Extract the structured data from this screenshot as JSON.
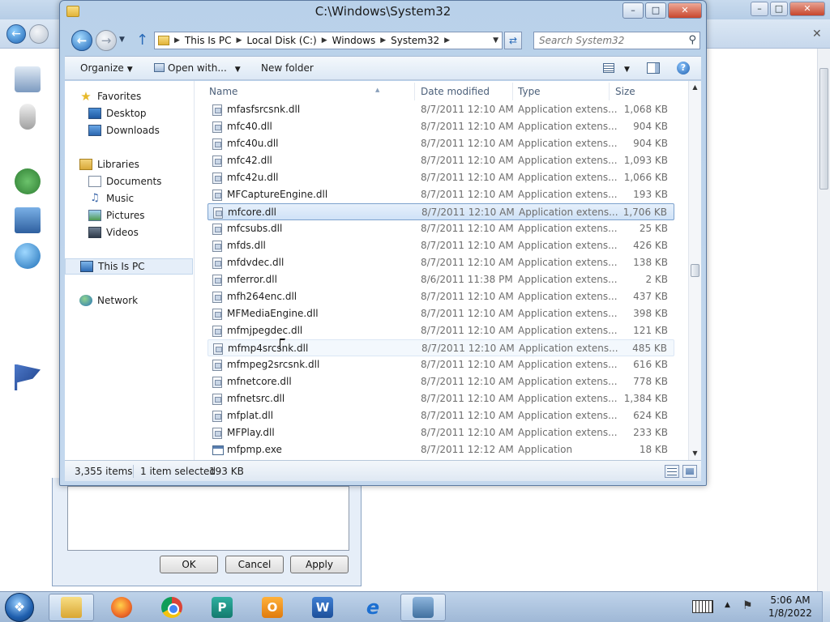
{
  "explorer": {
    "title": "C:\\Windows\\System32",
    "breadcrumb": [
      "This Is PC",
      "Local Disk (C:)",
      "Windows",
      "System32"
    ],
    "search_placeholder": "Search System32",
    "toolbar": {
      "organize": "Organize",
      "open_with": "Open with...",
      "new_folder": "New folder"
    },
    "nav": {
      "favorites": "Favorites",
      "desktop": "Desktop",
      "downloads": "Downloads",
      "libraries": "Libraries",
      "documents": "Documents",
      "music": "Music",
      "pictures": "Pictures",
      "videos": "Videos",
      "this_pc": "This Is PC",
      "network": "Network"
    },
    "columns": {
      "name": "Name",
      "date": "Date modified",
      "type": "Type",
      "size": "Size"
    },
    "files": [
      {
        "name": "mfasfsrcsnk.dll",
        "date": "8/7/2011 12:10 AM",
        "type": "Application extens...",
        "size": "1,068 KB"
      },
      {
        "name": "mfc40.dll",
        "date": "8/7/2011 12:10 AM",
        "type": "Application extens...",
        "size": "904 KB"
      },
      {
        "name": "mfc40u.dll",
        "date": "8/7/2011 12:10 AM",
        "type": "Application extens...",
        "size": "904 KB"
      },
      {
        "name": "mfc42.dll",
        "date": "8/7/2011 12:10 AM",
        "type": "Application extens...",
        "size": "1,093 KB"
      },
      {
        "name": "mfc42u.dll",
        "date": "8/7/2011 12:10 AM",
        "type": "Application extens...",
        "size": "1,066 KB"
      },
      {
        "name": "MFCaptureEngine.dll",
        "date": "8/7/2011 12:10 AM",
        "type": "Application extens...",
        "size": "193 KB"
      },
      {
        "name": "mfcore.dll",
        "date": "8/7/2011 12:10 AM",
        "type": "Application extens...",
        "size": "1,706 KB"
      },
      {
        "name": "mfcsubs.dll",
        "date": "8/7/2011 12:10 AM",
        "type": "Application extens...",
        "size": "25 KB"
      },
      {
        "name": "mfds.dll",
        "date": "8/7/2011 12:10 AM",
        "type": "Application extens...",
        "size": "426 KB"
      },
      {
        "name": "mfdvdec.dll",
        "date": "8/7/2011 12:10 AM",
        "type": "Application extens...",
        "size": "138 KB"
      },
      {
        "name": "mferror.dll",
        "date": "8/6/2011 11:38 PM",
        "type": "Application extens...",
        "size": "2 KB"
      },
      {
        "name": "mfh264enc.dll",
        "date": "8/7/2011 12:10 AM",
        "type": "Application extens...",
        "size": "437 KB"
      },
      {
        "name": "MFMediaEngine.dll",
        "date": "8/7/2011 12:10 AM",
        "type": "Application extens...",
        "size": "398 KB"
      },
      {
        "name": "mfmjpegdec.dll",
        "date": "8/7/2011 12:10 AM",
        "type": "Application extens...",
        "size": "121 KB"
      },
      {
        "name": "mfmp4srcsnk.dll",
        "date": "8/7/2011 12:10 AM",
        "type": "Application extens...",
        "size": "485 KB"
      },
      {
        "name": "mfmpeg2srcsnk.dll",
        "date": "8/7/2011 12:10 AM",
        "type": "Application extens...",
        "size": "616 KB"
      },
      {
        "name": "mfnetcore.dll",
        "date": "8/7/2011 12:10 AM",
        "type": "Application extens...",
        "size": "778 KB"
      },
      {
        "name": "mfnetsrc.dll",
        "date": "8/7/2011 12:10 AM",
        "type": "Application extens...",
        "size": "1,384 KB"
      },
      {
        "name": "mfplat.dll",
        "date": "8/7/2011 12:10 AM",
        "type": "Application extens...",
        "size": "624 KB"
      },
      {
        "name": "MFPlay.dll",
        "date": "8/7/2011 12:10 AM",
        "type": "Application extens...",
        "size": "233 KB"
      },
      {
        "name": "mfpmp.exe",
        "date": "8/7/2011 12:12 AM",
        "type": "Application",
        "size": "18 KB"
      }
    ],
    "status": {
      "item_count": "3,355 items",
      "selection": "1 item selected",
      "selection_size": "193 KB"
    }
  },
  "properties_dialog": {
    "ok": "OK",
    "cancel": "Cancel",
    "apply": "Apply"
  },
  "taskbar": {
    "apps": [
      "windows-explorer",
      "firefox",
      "chrome",
      "publisher",
      "outlook",
      "word",
      "internet-explorer",
      "control-panel"
    ],
    "clock_time": "5:06 AM",
    "clock_date": "1/8/2022"
  },
  "colors": {
    "selection": "#cfe2f7",
    "chrome_blue": "#b9d1ea",
    "taskbar": "#9fb8d6"
  }
}
